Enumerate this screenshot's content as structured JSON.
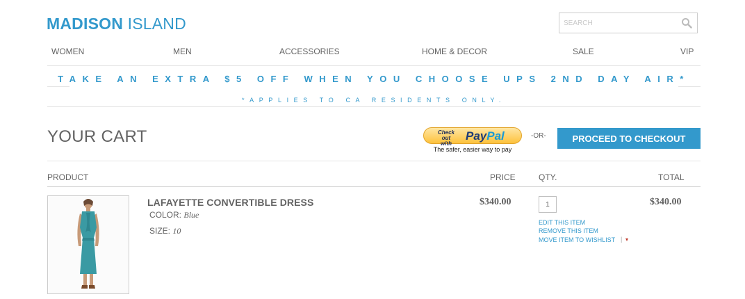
{
  "header": {
    "logo_bold": "MADISON",
    "logo_light": " ISLAND",
    "search_placeholder": "SEARCH"
  },
  "nav": {
    "items": [
      "WOMEN",
      "MEN",
      "ACCESSORIES",
      "HOME & DECOR",
      "SALE",
      "VIP"
    ]
  },
  "promo": {
    "headline": "TAKE AN EXTRA $5 OFF WHEN YOU CHOOSE UPS 2ND DAY AIR*",
    "subline": "*APPLIES TO CA RESIDENTS ONLY."
  },
  "cart": {
    "title": "YOUR CART",
    "paypal_checkout_line1": "Check out",
    "paypal_checkout_line2": "with",
    "paypal_brand_1": "Pay",
    "paypal_brand_2": "Pal",
    "paypal_tagline": "The safer, easier way to pay",
    "or_label": "-OR-",
    "proceed_label": "PROCEED TO CHECKOUT"
  },
  "table": {
    "headers": {
      "product": "PRODUCT",
      "price": "PRICE",
      "qty": "QTY.",
      "total": "TOTAL"
    },
    "items": [
      {
        "name": "LAFAYETTE CONVERTIBLE DRESS",
        "color_label": "COLOR:",
        "color_value": "Blue",
        "size_label": "SIZE:",
        "size_value": "10",
        "price": "$340.00",
        "qty": "1",
        "total": "$340.00",
        "edit_label": "EDIT THIS ITEM",
        "remove_label": "REMOVE THIS ITEM",
        "wishlist_label": "MOVE ITEM TO WISHLIST",
        "wishlist_separator": "|",
        "dropdown_icon": "▾"
      }
    ]
  },
  "colors": {
    "accent": "#3399cc",
    "text": "#636363",
    "border": "#e5e5e5"
  }
}
